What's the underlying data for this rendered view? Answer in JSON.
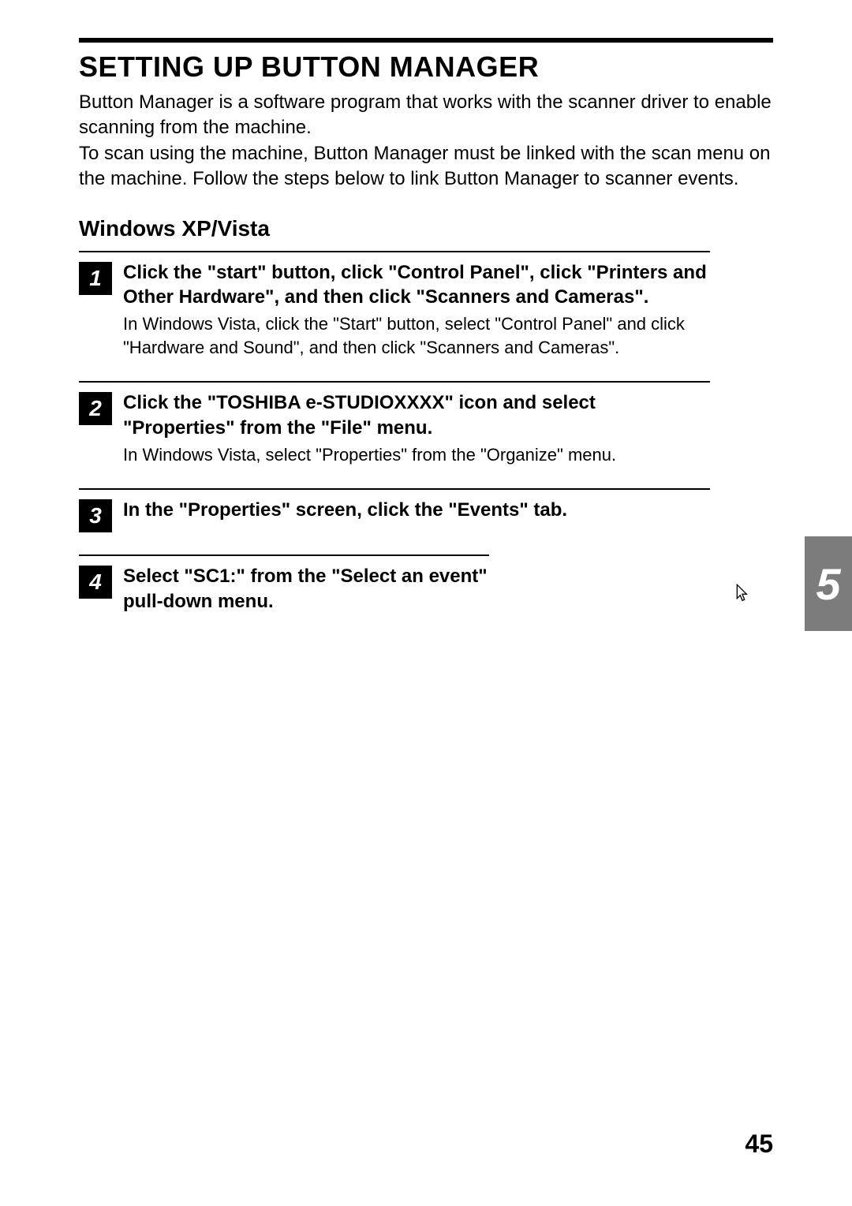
{
  "title": "SETTING UP BUTTON MANAGER",
  "intro1": "Button Manager is a software program that works with the scanner driver to enable scanning from  the machine.",
  "intro2": "To scan using the machine, Button Manager must be linked with the scan menu on the machine. Follow the steps below to link Button Manager to scanner events.",
  "subhead": "Windows XP/Vista",
  "steps": [
    {
      "num": "1",
      "head": "Click the \"start\" button, click \"Control Panel\", click \"Printers and Other Hardware\", and then click \"Scanners and Cameras\".",
      "sub": "In Windows Vista, click the \"Start\" button, select \"Control Panel\" and click \"Hardware and Sound\", and then click \"Scanners and Cameras\"."
    },
    {
      "num": "2",
      "head": "Click the \"TOSHIBA e-STUDIOXXXX\" icon and select \"Properties\" from the \"File\" menu.",
      "sub": "In Windows Vista, select \"Properties\" from the \"Organize\" menu."
    },
    {
      "num": "3",
      "head": "In the \"Properties\" screen, click the \"Events\" tab.",
      "sub": ""
    },
    {
      "num": "4",
      "head": "Select \"SC1:\" from the \"Select an event\" pull-down menu.",
      "sub": ""
    }
  ],
  "chapter": "5",
  "cursor_glyph": "↖",
  "page_number": "45"
}
